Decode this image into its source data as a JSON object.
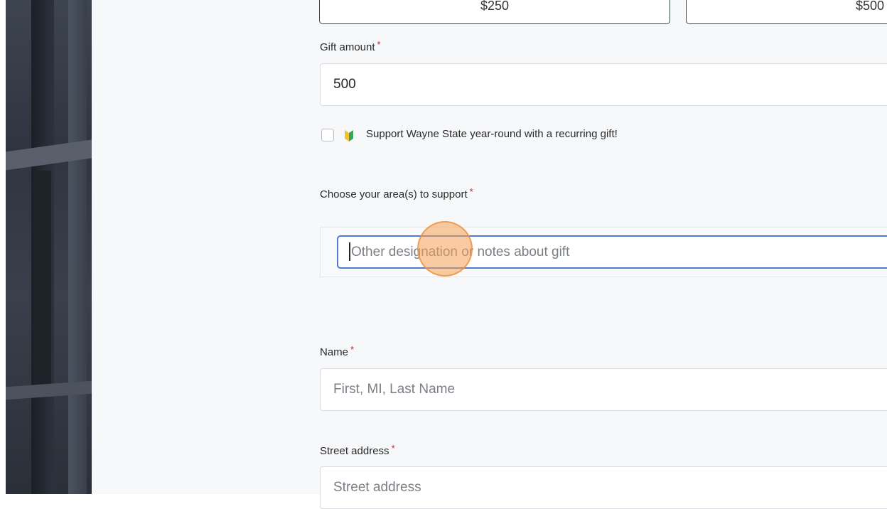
{
  "amount_options": [
    "$250",
    "$500"
  ],
  "gift_amount": {
    "label": "Gift amount",
    "required_mark": "*",
    "value": "500"
  },
  "recurring": {
    "checked": false,
    "label": "Support Wayne State year-round with a recurring gift!",
    "icon": "leaf-icon"
  },
  "designation": {
    "label": "Choose your area(s) to support",
    "required_mark": "*",
    "placeholder": "Other designation or notes about gift"
  },
  "name_field": {
    "label": "Name",
    "required_mark": "*",
    "placeholder": "First, MI, Last Name"
  },
  "street_field": {
    "label": "Street address",
    "required_mark": "*",
    "placeholder": "Street address"
  },
  "colors": {
    "accent": "#4e7bd0",
    "required": "#c0272d",
    "button_border": "#2f4a3e"
  }
}
